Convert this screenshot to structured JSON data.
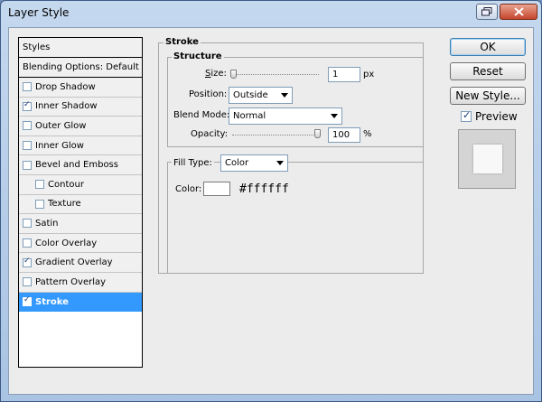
{
  "window": {
    "title": "Layer Style"
  },
  "styles_panel": {
    "header": "Styles",
    "blending_options": "Blending Options: Default",
    "items": [
      {
        "label": "Drop Shadow",
        "checked": false,
        "indent": false,
        "selected": false
      },
      {
        "label": "Inner Shadow",
        "checked": true,
        "indent": false,
        "selected": false
      },
      {
        "label": "Outer Glow",
        "checked": false,
        "indent": false,
        "selected": false
      },
      {
        "label": "Inner Glow",
        "checked": false,
        "indent": false,
        "selected": false
      },
      {
        "label": "Bevel and Emboss",
        "checked": false,
        "indent": false,
        "selected": false
      },
      {
        "label": "Contour",
        "checked": false,
        "indent": true,
        "selected": false
      },
      {
        "label": "Texture",
        "checked": false,
        "indent": true,
        "selected": false
      },
      {
        "label": "Satin",
        "checked": false,
        "indent": false,
        "selected": false
      },
      {
        "label": "Color Overlay",
        "checked": false,
        "indent": false,
        "selected": false
      },
      {
        "label": "Gradient Overlay",
        "checked": true,
        "indent": false,
        "selected": false
      },
      {
        "label": "Pattern Overlay",
        "checked": false,
        "indent": false,
        "selected": false
      },
      {
        "label": "Stroke",
        "checked": true,
        "indent": false,
        "selected": true
      }
    ]
  },
  "stroke": {
    "title": "Stroke",
    "structure": {
      "title": "Structure",
      "size_label": "Size:",
      "size_value": "1",
      "size_unit": "px",
      "size_slider_fraction": 0.0,
      "position_label": "Position:",
      "position_value": "Outside",
      "blend_mode_label": "Blend Mode:",
      "blend_mode_value": "Normal",
      "opacity_label": "Opacity:",
      "opacity_value": "100",
      "opacity_unit": "%",
      "opacity_slider_fraction": 1.0
    },
    "fill": {
      "fill_type_label": "Fill Type:",
      "fill_type_value": "Color",
      "color_label": "Color:",
      "color_hex": "#ffffff"
    }
  },
  "buttons": {
    "ok": "OK",
    "reset": "Reset",
    "new_style": "New Style...",
    "preview_label": "Preview",
    "preview_checked": true
  },
  "colors": {
    "selection": "#3399ff",
    "swatch": "#ffffff"
  }
}
